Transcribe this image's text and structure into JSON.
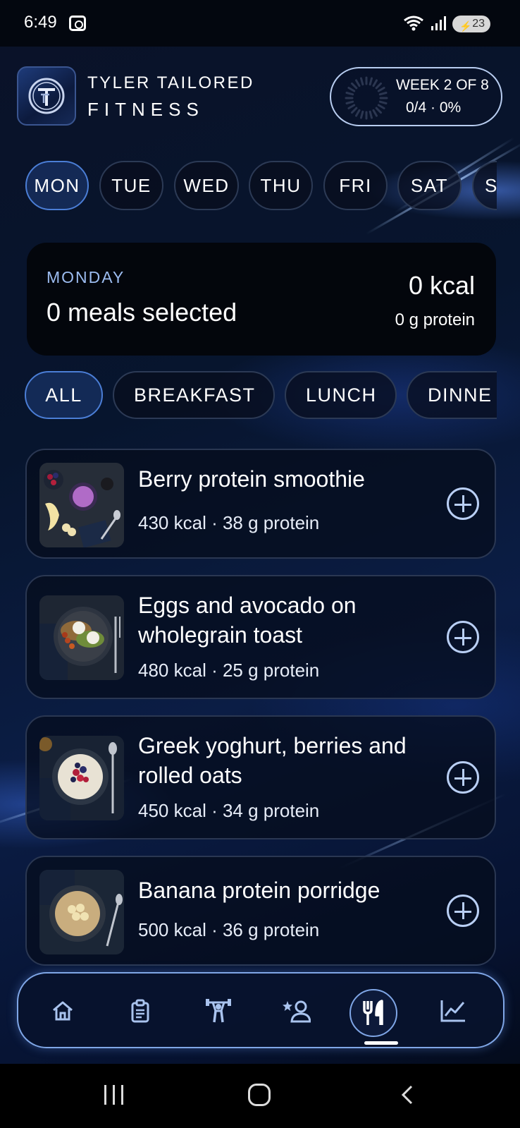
{
  "status_bar": {
    "time": "6:49",
    "battery": "23",
    "icons": [
      "screenshot-icon",
      "wifi-icon",
      "signal-icon",
      "battery-icon"
    ]
  },
  "header": {
    "brand_line1": "TYLER TAILORED",
    "brand_line2": "FITNESS",
    "week_title": "WEEK 2 OF 8",
    "week_progress": "0/4 · 0%",
    "progress_fraction": 0
  },
  "days": [
    {
      "label": "MON",
      "active": true
    },
    {
      "label": "TUE",
      "active": false
    },
    {
      "label": "WED",
      "active": false
    },
    {
      "label": "THU",
      "active": false
    },
    {
      "label": "FRI",
      "active": false
    },
    {
      "label": "SAT",
      "active": false
    },
    {
      "label": "S",
      "active": false
    }
  ],
  "summary": {
    "day": "MONDAY",
    "meals_selected": "0 meals selected",
    "kcal": "0 kcal",
    "protein": "0 g protein"
  },
  "filters": [
    {
      "label": "ALL",
      "active": true
    },
    {
      "label": "BREAKFAST",
      "active": false
    },
    {
      "label": "LUNCH",
      "active": false
    },
    {
      "label": "DINNE",
      "active": false
    }
  ],
  "meals": [
    {
      "name": "Berry protein smoothie",
      "macros": "430 kcal · 38 g protein"
    },
    {
      "name": "Eggs and avocado on wholegrain toast",
      "macros": "480 kcal · 25 g protein"
    },
    {
      "name": "Greek yoghurt, berries and rolled oats",
      "macros": "450 kcal · 34 g protein"
    },
    {
      "name": "Banana protein porridge",
      "macros": "500 kcal · 36 g protein"
    }
  ],
  "bottom_nav": {
    "items": [
      "home-icon",
      "clipboard-icon",
      "weightlifter-icon",
      "coach-icon",
      "cutlery-icon",
      "chart-icon"
    ],
    "active": "cutlery-icon"
  },
  "colors": {
    "accent": "#7fa6e6",
    "chip_active_border": "#4b7ed6",
    "label_blue": "#9cbcf0",
    "background": "#07152e"
  }
}
